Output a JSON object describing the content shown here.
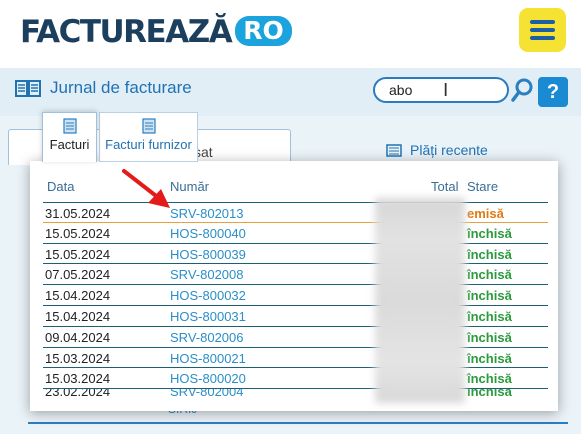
{
  "header": {
    "logo_main": "FACTUREAZĂ",
    "logo_tld": "RO"
  },
  "toolbar": {
    "journal_label": "Jurnal de facturare",
    "search_value": "abo",
    "help_label": "?"
  },
  "background": {
    "tab_partial": "sat",
    "payments_label": "Plăți recente",
    "partial_code": "SIRIJ"
  },
  "tabs": [
    {
      "label": "Facturi"
    },
    {
      "label": "Facturi furnizor"
    }
  ],
  "table": {
    "headers": {
      "date": "Data",
      "number": "Număr",
      "total": "Total",
      "status": "Stare"
    },
    "rows": [
      {
        "date": "31.05.2024",
        "number": "SRV-802013",
        "status": "emisă"
      },
      {
        "date": "15.05.2024",
        "number": "HOS-800040",
        "status": "închisă"
      },
      {
        "date": "15.05.2024",
        "number": "HOS-800039",
        "status": "închisă"
      },
      {
        "date": "07.05.2024",
        "number": "SRV-802008",
        "status": "închisă"
      },
      {
        "date": "15.04.2024",
        "number": "HOS-800032",
        "status": "închisă"
      },
      {
        "date": "15.04.2024",
        "number": "HOS-800031",
        "status": "închisă"
      },
      {
        "date": "09.04.2024",
        "number": "SRV-802006",
        "status": "închisă"
      },
      {
        "date": "15.03.2024",
        "number": "HOS-800021",
        "status": "închisă"
      },
      {
        "date": "15.03.2024",
        "number": "HOS-800020",
        "status": "închisă"
      },
      {
        "date": "23.02.2024",
        "number": "SRV-802004",
        "status": "închisă"
      }
    ]
  },
  "colors": {
    "emisa": "#e07b12",
    "inchisa": "#2a9a3c",
    "accent": "#2172b3",
    "menu_bg": "#f5e232"
  }
}
